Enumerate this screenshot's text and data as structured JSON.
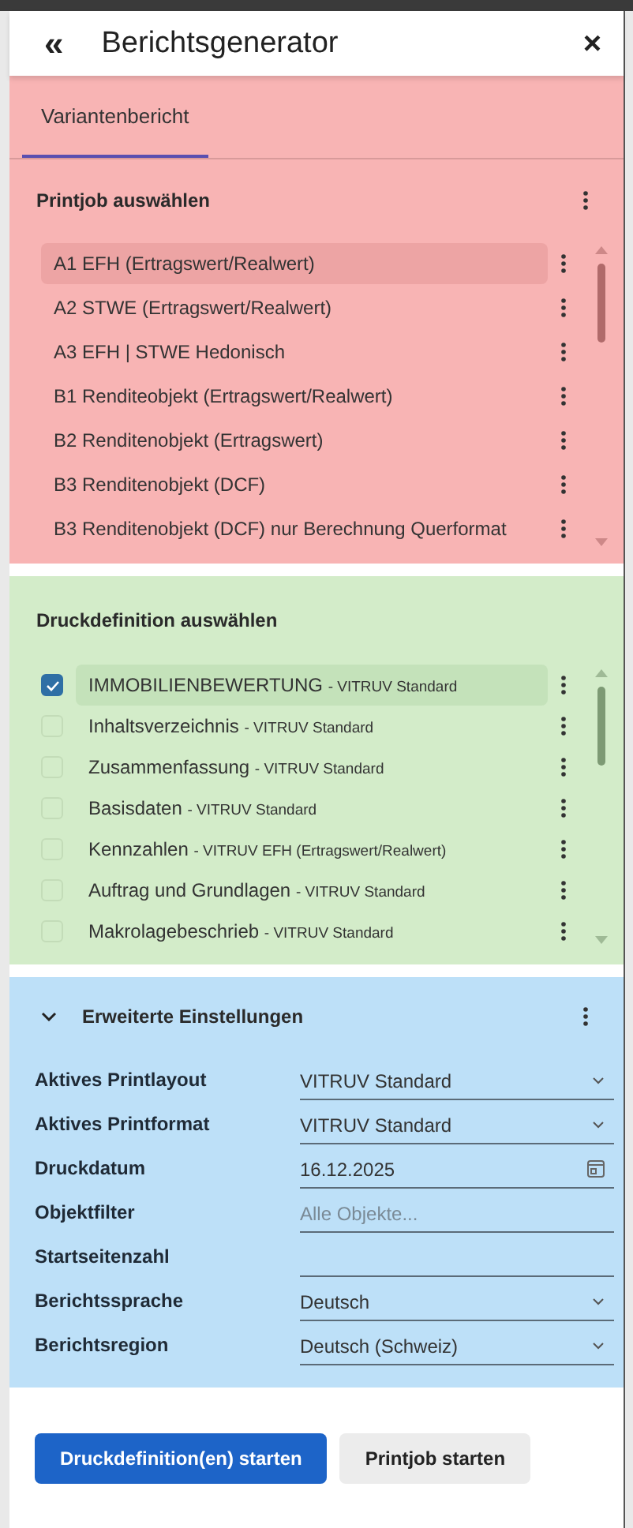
{
  "header": {
    "title": "Berichtsgenerator",
    "collapse_icon": "«",
    "close_icon": "×"
  },
  "tabs": [
    {
      "label": "Variantenbericht",
      "selected": true
    }
  ],
  "printjobs": {
    "title": "Printjob auswählen",
    "items": [
      {
        "label": "A1 EFH (Ertragswert/Realwert)",
        "selected": true
      },
      {
        "label": "A2 STWE (Ertragswert/Realwert)",
        "selected": false
      },
      {
        "label": "A3 EFH | STWE Hedonisch",
        "selected": false
      },
      {
        "label": "B1 Renditeobjekt (Ertragswert/Realwert)",
        "selected": false
      },
      {
        "label": "B2 Renditenobjekt (Ertragswert)",
        "selected": false
      },
      {
        "label": "B3 Renditenobjekt (DCF)",
        "selected": false
      },
      {
        "label": "B3 Renditenobjekt (DCF) nur Berechnung Querformat",
        "selected": false
      }
    ]
  },
  "definitions": {
    "title": "Druckdefinition auswählen",
    "items": [
      {
        "name": "IMMOBILIENBEWERTUNG",
        "source": "- VITRUV Standard",
        "checked": true,
        "selected": true
      },
      {
        "name": "Inhaltsverzeichnis",
        "source": "- VITRUV Standard",
        "checked": false,
        "selected": false
      },
      {
        "name": "Zusammenfassung",
        "source": "- VITRUV Standard",
        "checked": false,
        "selected": false
      },
      {
        "name": "Basisdaten",
        "source": "- VITRUV Standard",
        "checked": false,
        "selected": false
      },
      {
        "name": "Kennzahlen",
        "source": "- VITRUV EFH (Ertragswert/Realwert)",
        "checked": false,
        "selected": false
      },
      {
        "name": "Auftrag und Grundlagen",
        "source": "- VITRUV Standard",
        "checked": false,
        "selected": false
      },
      {
        "name": "Makrolagebeschrieb",
        "source": "- VITRUV Standard",
        "checked": false,
        "selected": false
      }
    ]
  },
  "settings": {
    "title": "Erweiterte Einstellungen",
    "expanded": true,
    "fields": [
      {
        "label": "Aktives Printlayout",
        "kind": "select",
        "value": "VITRUV Standard"
      },
      {
        "label": "Aktives Printformat",
        "kind": "select",
        "value": "VITRUV Standard"
      },
      {
        "label": "Druckdatum",
        "kind": "date",
        "value": "16.12.2025"
      },
      {
        "label": "Objektfilter",
        "kind": "text",
        "placeholder": "Alle Objekte..."
      },
      {
        "label": "Startseitenzahl",
        "kind": "text"
      },
      {
        "label": "Berichtssprache",
        "kind": "select",
        "value": "Deutsch"
      },
      {
        "label": "Berichtsregion",
        "kind": "select",
        "value": "Deutsch (Schweiz)"
      }
    ]
  },
  "buttons": [
    {
      "label": "Druckdefinition(en) starten",
      "kind": "primary"
    },
    {
      "label": "Printjob starten",
      "kind": "secondary"
    }
  ]
}
